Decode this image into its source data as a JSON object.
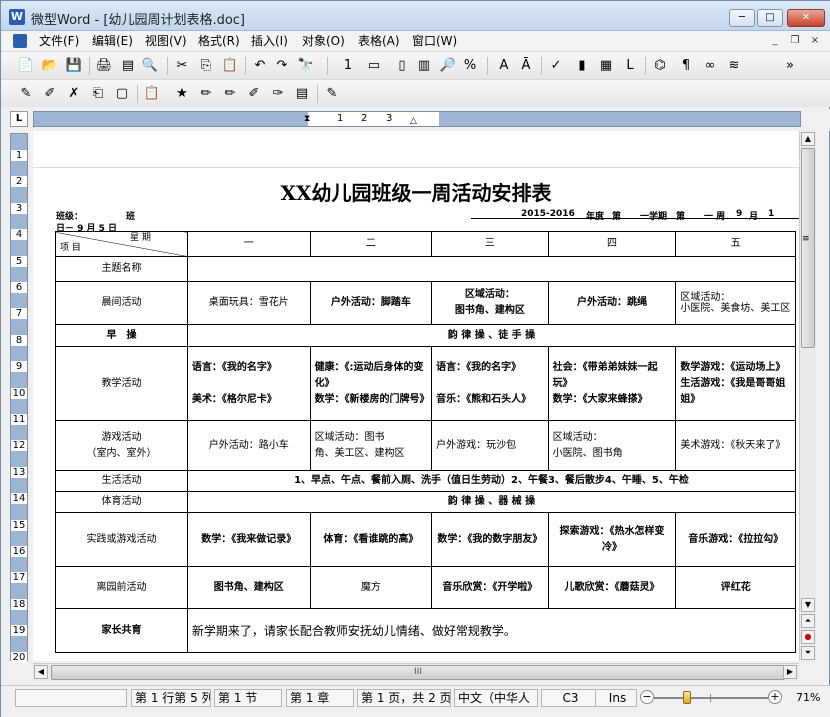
{
  "window": {
    "app_icon": "W",
    "title": "微型Word - [幼儿园周计划表格.doc]",
    "minimize": "─",
    "restore": "□",
    "close": "✕"
  },
  "menu": [
    "文件(F)",
    "编辑(E)",
    "视图(V)",
    "格式(R)",
    "插入(I)",
    "对象(O)",
    "表格(A)",
    "窗口(W)"
  ],
  "mdi_controls": {
    "minimize": "_",
    "restore": "❐",
    "close": "×"
  },
  "toolbar1": [
    {
      "name": "new-doc-icon",
      "glyph": "📄"
    },
    {
      "name": "open-folder-icon",
      "glyph": "📂"
    },
    {
      "name": "save-icon",
      "glyph": "💾"
    },
    {
      "name": "print-icon",
      "glyph": "🖨"
    },
    {
      "name": "pdf-icon",
      "glyph": "▤"
    },
    {
      "name": "print-preview-icon",
      "glyph": "🔍"
    },
    {
      "name": "cut-icon",
      "glyph": "✂"
    },
    {
      "name": "copy-icon",
      "glyph": "⎘"
    },
    {
      "name": "paste-icon",
      "glyph": "📋"
    },
    {
      "name": "undo-icon",
      "glyph": "↶"
    },
    {
      "name": "redo-icon",
      "glyph": "↷"
    },
    {
      "name": "find-icon",
      "glyph": "🔭"
    },
    {
      "name": "page-number-icon",
      "glyph": "1"
    },
    {
      "name": "header-footer-icon",
      "glyph": "▭"
    },
    {
      "name": "page-setup-icon",
      "glyph": "▯"
    },
    {
      "name": "columns-icon",
      "glyph": "▥"
    },
    {
      "name": "zoom-icon",
      "glyph": "🔎"
    },
    {
      "name": "replace-icon",
      "glyph": "%"
    },
    {
      "name": "font-color-icon",
      "glyph": "A"
    },
    {
      "name": "font-settings-icon",
      "glyph": "Ā"
    },
    {
      "name": "spell-check-icon",
      "glyph": "✓"
    },
    {
      "name": "bookmark-icon",
      "glyph": "▮"
    },
    {
      "name": "layers-icon",
      "glyph": "▦"
    },
    {
      "name": "letter-icon",
      "glyph": "L"
    },
    {
      "name": "binoculars-icon",
      "glyph": "⌬"
    },
    {
      "name": "paragraph-icon",
      "glyph": "¶"
    },
    {
      "name": "link-icon",
      "glyph": "∞"
    },
    {
      "name": "stack-icon",
      "glyph": "≋"
    },
    {
      "name": "more-icon",
      "glyph": "»"
    }
  ],
  "toolbar2": [
    {
      "name": "highlight-icon",
      "glyph": "✎"
    },
    {
      "name": "edit-icon",
      "glyph": "✐"
    },
    {
      "name": "delete-icon",
      "glyph": "✗"
    },
    {
      "name": "copy-format-icon",
      "glyph": "⎗"
    },
    {
      "name": "doc-icon",
      "glyph": "▢"
    },
    {
      "name": "clipboard-icon",
      "glyph": "📋"
    },
    {
      "name": "star-pen-icon",
      "glyph": "★"
    },
    {
      "name": "pen-green-icon",
      "glyph": "✏"
    },
    {
      "name": "pen-yellow-icon",
      "glyph": "✏"
    },
    {
      "name": "pen-outline-icon",
      "glyph": "✐"
    },
    {
      "name": "pen-double-icon",
      "glyph": "✑"
    },
    {
      "name": "notes-icon",
      "glyph": "▤"
    },
    {
      "name": "document-edit-icon",
      "glyph": "✎"
    }
  ],
  "ruler": {
    "corner": "L",
    "marks": [
      "1",
      "2",
      "3"
    ]
  },
  "vertical_ruler": [
    "1",
    "2",
    "3",
    "4",
    "5",
    "6",
    "7",
    "8",
    "9",
    "10",
    "11",
    "12",
    "13",
    "14",
    "15",
    "16",
    "17",
    "18",
    "19",
    "20"
  ],
  "doc": {
    "title": "XX幼儿园班级一周活动安排表",
    "class_label": "班级：",
    "class_suffix": "班",
    "date_label": "日－ 9  月  5  日",
    "year": "2015-2016",
    "year_label": "年度",
    "term": "第",
    "term_label": "一学期",
    "week_prefix": "第",
    "week_label": "一 周",
    "month": "9",
    "month_label": "月",
    "day_trunc": "1",
    "table": {
      "head_xingqi": "星 期",
      "head_xiangmu": "项 目",
      "days": [
        "一",
        "二",
        "三",
        "四",
        "五"
      ],
      "rows": [
        {
          "label": "主题名称",
          "merged": ""
        },
        {
          "label": "晨间活动",
          "cells": [
            "桌面玩具：雪花片",
            "户外活动：脚踏车",
            "区域活动：\n图书角、建构区",
            "户外活动：跳绳",
            "区域活动：\n小医院、美食坊、美工区"
          ]
        },
        {
          "label": "早　操",
          "merged": "韵 律 操 、徒 手 操"
        },
        {
          "label": "教学活动",
          "cells": [
            "语言：《我的名字》\n\n美术：《格尔尼卡》",
            "健康：《:运动后身体的变化》\n数学：《新楼房的门牌号》",
            "语言：《我的名字》\n\n音乐：《熊和石头人》",
            "社会：《带弟弟妹妹一起玩》\n数学：《大家来蜂搽》",
            "数学游戏：《运动场上》\n生活游戏：《我是哥哥姐姐》"
          ]
        },
        {
          "label": "游戏活动\n（室内、室外）",
          "cells": [
            "户外活动：路小车",
            "区域活动：图书\n角、美工区、建构区",
            "户外游戏：玩沙包",
            "区域活动：\n小医院、图书角",
            "美术游戏：《秋天来了》"
          ]
        },
        {
          "label": "生活活动",
          "merged": "1、早点、午点、餐前入厕、洗手（值日生劳动）2、午餐3、餐后散步4、午睡、5、午检"
        },
        {
          "label": "体育活动",
          "merged": "韵 律 操 、器 械 操"
        },
        {
          "label": "实践或游戏活动",
          "cells": [
            "数学：《我来做记录》",
            "体育：《看谁跳的高》",
            "数学：《我的数字朋友》",
            "探索游戏：《热水怎样变冷》",
            "音乐游戏：《拉拉勾》"
          ]
        },
        {
          "label": "离园前活动",
          "cells": [
            "图书角、建构区",
            "魔方",
            "音乐欣赏：《开学啦》",
            "儿歌欣赏：《蘑菇灵》",
            "评红花"
          ]
        },
        {
          "label": "家长共育",
          "merged": "新学期来了，请家长配合教师安抚幼儿情绪、做好常规教学。"
        }
      ]
    }
  },
  "hscroll_grip": "III",
  "status": {
    "line_col": "第 1 行第 5 列",
    "section": "第 1 节",
    "chapter": "第 1 章",
    "page": "第 1 页，共 2 页",
    "lang": "中文（中华人",
    "cell": "C3",
    "ins": "Ins",
    "zoom_minus": "−",
    "zoom_plus": "+",
    "zoom": "71%",
    "zoom_level": 0.3
  }
}
